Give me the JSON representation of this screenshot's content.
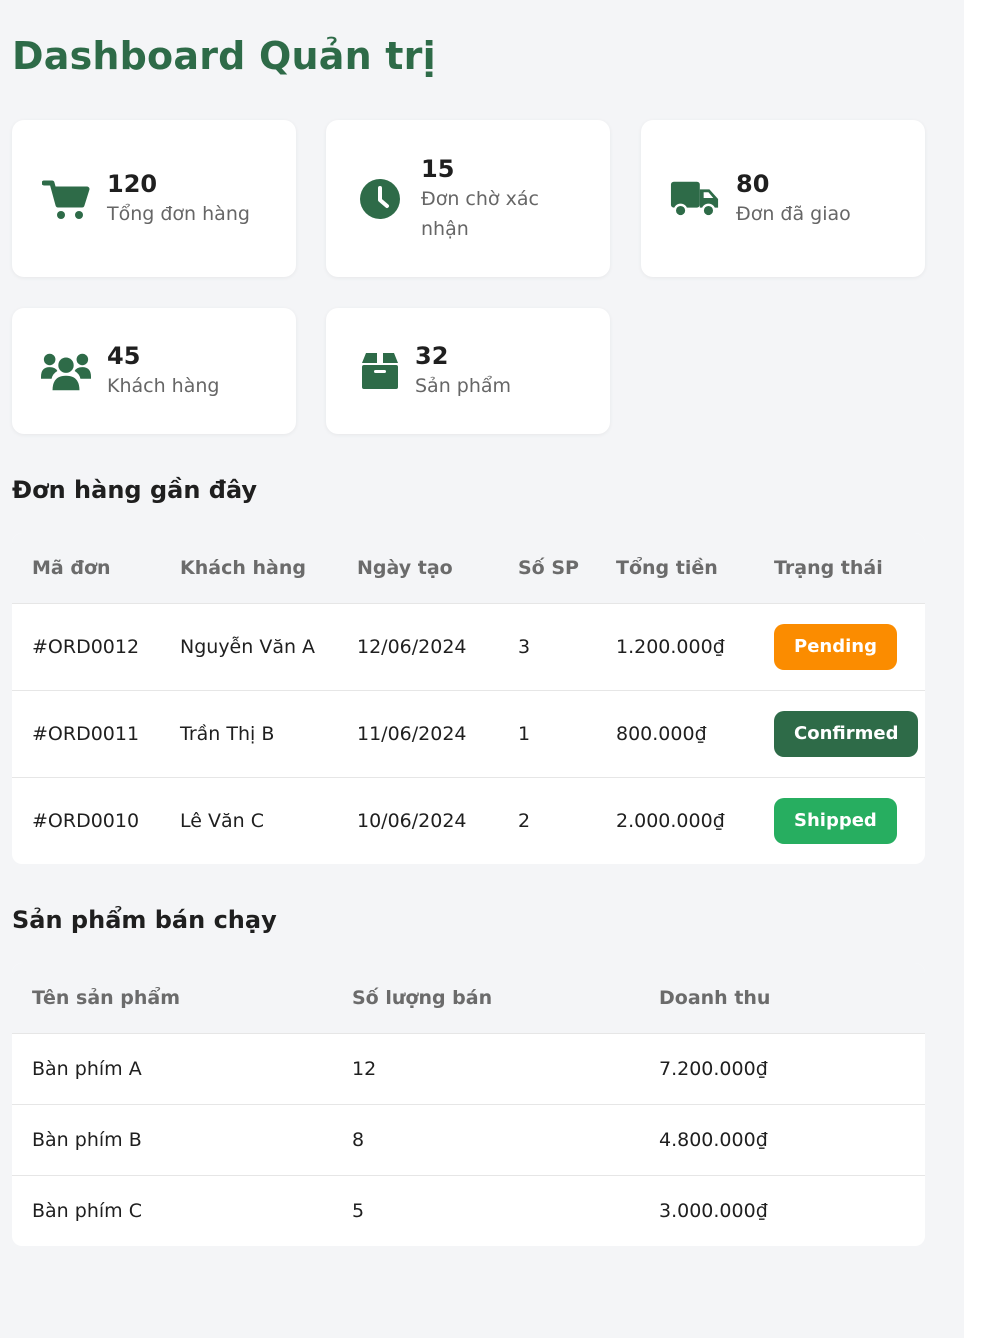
{
  "page": {
    "title": "Dashboard Quản trị"
  },
  "stats": [
    {
      "value": "120",
      "label": "Tổng đơn hàng",
      "icon": "cart-icon"
    },
    {
      "value": "15",
      "label": "Đơn chờ xác nhận",
      "icon": "clock-icon"
    },
    {
      "value": "80",
      "label": "Đơn đã giao",
      "icon": "truck-icon"
    },
    {
      "value": "45",
      "label": "Khách hàng",
      "icon": "users-icon"
    },
    {
      "value": "32",
      "label": "Sản phẩm",
      "icon": "box-icon"
    }
  ],
  "recent_orders": {
    "title": "Đơn hàng gần đây",
    "headers": [
      "Mã đơn",
      "Khách hàng",
      "Ngày tạo",
      "Số SP",
      "Tổng tiền",
      "Trạng thái"
    ],
    "rows": [
      {
        "id": "#ORD0012",
        "customer": "Nguyễn Văn A",
        "date": "12/06/2024",
        "qty": "3",
        "total": "1.200.000₫",
        "status": "Pending",
        "status_color": "#fb8c00"
      },
      {
        "id": "#ORD0011",
        "customer": "Trần Thị B",
        "date": "11/06/2024",
        "qty": "1",
        "total": "800.000₫",
        "status": "Confirmed",
        "status_color": "#2e6b48"
      },
      {
        "id": "#ORD0010",
        "customer": "Lê Văn C",
        "date": "10/06/2024",
        "qty": "2",
        "total": "2.000.000₫",
        "status": "Shipped",
        "status_color": "#27ae60"
      }
    ]
  },
  "top_products": {
    "title": "Sản phẩm bán chạy",
    "headers": [
      "Tên sản phẩm",
      "Số lượng bán",
      "Doanh thu"
    ],
    "rows": [
      {
        "name": "Bàn phím A",
        "sold": "12",
        "revenue": "7.200.000₫"
      },
      {
        "name": "Bàn phím B",
        "sold": "8",
        "revenue": "4.800.000₫"
      },
      {
        "name": "Bàn phím C",
        "sold": "5",
        "revenue": "3.000.000₫"
      }
    ]
  },
  "colors": {
    "accent": "#2e6b48",
    "background": "#f4f5f7"
  }
}
